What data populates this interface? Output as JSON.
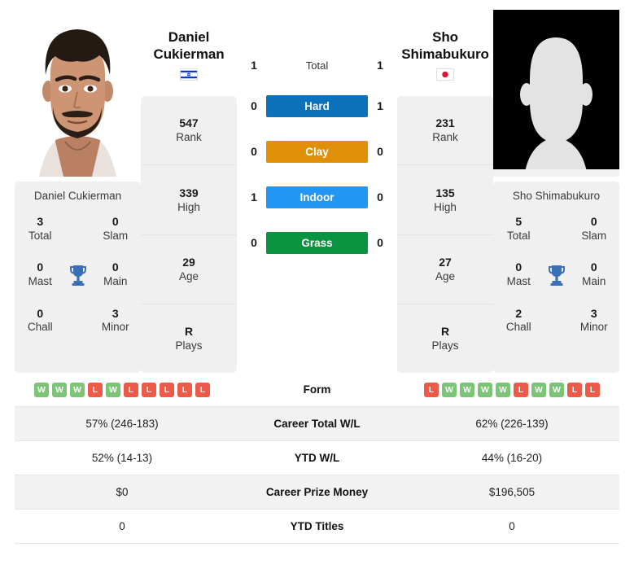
{
  "players": {
    "left": {
      "first_name": "Daniel",
      "last_name": "Cukierman",
      "full_name": "Daniel Cukierman",
      "flag": "israel-flag",
      "photo": "player-photo",
      "rank": "547",
      "rank_label": "Rank",
      "high": "339",
      "high_label": "High",
      "age": "29",
      "age_label": "Age",
      "plays": "R",
      "plays_label": "Plays",
      "titles": {
        "total": "3",
        "total_label": "Total",
        "slam": "0",
        "slam_label": "Slam",
        "mast": "0",
        "mast_label": "Mast",
        "main": "0",
        "main_label": "Main",
        "chall": "0",
        "chall_label": "Chall",
        "minor": "3",
        "minor_label": "Minor"
      },
      "form": [
        "W",
        "W",
        "W",
        "L",
        "W",
        "L",
        "L",
        "L",
        "L",
        "L"
      ],
      "career_wl": "57% (246-183)",
      "ytd_wl": "52% (14-13)",
      "prize_money": "$0",
      "ytd_titles": "0",
      "h2h": {
        "total": "1",
        "hard": "0",
        "clay": "0",
        "indoor": "1",
        "grass": "0"
      }
    },
    "right": {
      "first_name": "Sho",
      "last_name": "Shimabukuro",
      "full_name": "Sho Shimabukuro",
      "flag": "japan-flag",
      "photo": "player-silhouette-placeholder",
      "rank": "231",
      "rank_label": "Rank",
      "high": "135",
      "high_label": "High",
      "age": "27",
      "age_label": "Age",
      "plays": "R",
      "plays_label": "Plays",
      "titles": {
        "total": "5",
        "total_label": "Total",
        "slam": "0",
        "slam_label": "Slam",
        "mast": "0",
        "mast_label": "Mast",
        "main": "0",
        "main_label": "Main",
        "chall": "2",
        "chall_label": "Chall",
        "minor": "3",
        "minor_label": "Minor"
      },
      "form": [
        "L",
        "W",
        "W",
        "W",
        "W",
        "L",
        "W",
        "W",
        "L",
        "L"
      ],
      "career_wl": "62% (226-139)",
      "ytd_wl": "44% (16-20)",
      "prize_money": "$196,505",
      "ytd_titles": "0",
      "h2h": {
        "total": "1",
        "hard": "1",
        "clay": "0",
        "indoor": "0",
        "grass": "0"
      }
    }
  },
  "surfaces": [
    {
      "key": "total",
      "label": "Total",
      "color": "transparent",
      "text_color": "#333333"
    },
    {
      "key": "hard",
      "label": "Hard",
      "color": "#0e72bb",
      "text_color": "#ffffff"
    },
    {
      "key": "clay",
      "label": "Clay",
      "color": "#df8f08",
      "text_color": "#ffffff"
    },
    {
      "key": "indoor",
      "label": "Indoor",
      "color": "#2196f3",
      "text_color": "#ffffff"
    },
    {
      "key": "grass",
      "label": "Grass",
      "color": "#0a9442",
      "text_color": "#ffffff"
    }
  ],
  "table_rows": [
    {
      "key": "form",
      "label": "Form"
    },
    {
      "key": "career_wl",
      "label": "Career Total W/L"
    },
    {
      "key": "ytd_wl",
      "label": "YTD W/L"
    },
    {
      "key": "prize_money",
      "label": "Career Prize Money"
    },
    {
      "key": "ytd_titles",
      "label": "YTD Titles"
    }
  ],
  "colors": {
    "win_badge": "#7cc576",
    "loss_badge": "#ee5a48",
    "trophy": "#3a70b8",
    "card_bg": "#f0f0f0",
    "row_alt_bg": "#f2f2f2"
  },
  "icons": {
    "trophy": "trophy-icon"
  }
}
